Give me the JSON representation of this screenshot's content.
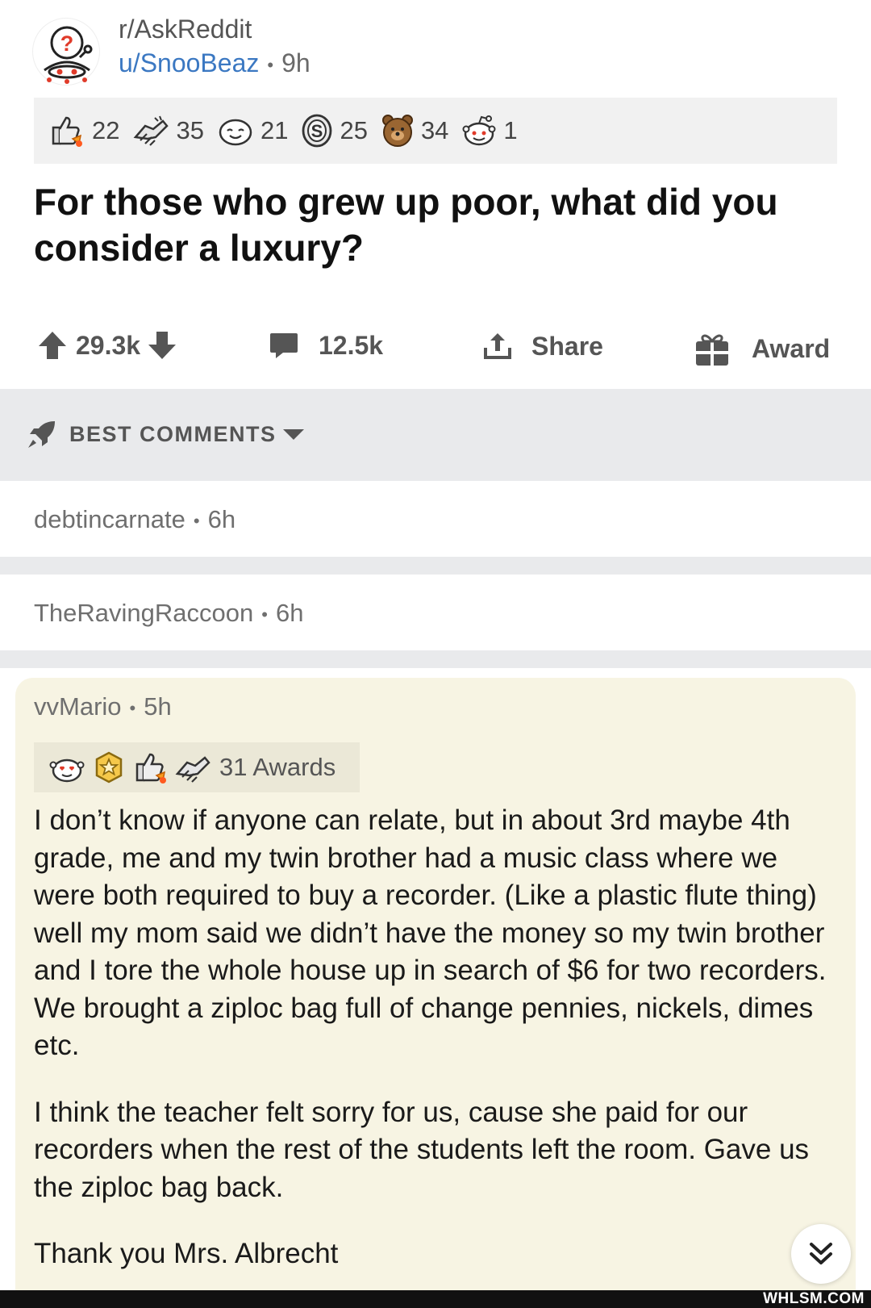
{
  "post": {
    "subreddit": "r/AskReddit",
    "author": "u/SnooBeaz",
    "age": "9h",
    "title": "For those who grew up poor, what did you consider a luxury?",
    "awards": [
      {
        "icon": "thumbs-rocket-icon",
        "count": "22"
      },
      {
        "icon": "helping-hands-icon",
        "count": "35"
      },
      {
        "icon": "wholesome-face-icon",
        "count": "21"
      },
      {
        "icon": "silver-coin-icon",
        "count": "25"
      },
      {
        "icon": "bear-icon",
        "count": "34"
      },
      {
        "icon": "snoo-face-icon",
        "count": "1"
      }
    ]
  },
  "actions": {
    "votes": "29.3k",
    "comments": "12.5k",
    "share": "Share",
    "award": "Award"
  },
  "sort": {
    "label": "BEST COMMENTS"
  },
  "collapsed_comments": [
    {
      "author": "debtincarnate",
      "age": "6h"
    },
    {
      "author": "TheRavingRaccoon",
      "age": "6h"
    }
  ],
  "comment": {
    "author": "vvMario",
    "age": "5h",
    "awards_label": "31 Awards",
    "paragraphs": [
      "I don’t know if anyone can relate, but in about 3rd maybe 4th grade, me and my twin brother had a music class where we were both required to buy a recorder. (Like a plastic flute thing) well my mom said we didn’t have the money so my twin brother and I tore the whole house up in search of $6 for two recorders. We brought a ziploc bag full of change pennies, nickels, dimes etc.",
      "I think the teacher felt sorry for us, cause she paid for our recorders when the rest of the students left the room. Gave us the ziploc bag back.",
      "Thank you Mrs. Albrecht"
    ]
  },
  "watermark": "WHLSM.COM",
  "colors": {
    "username_blue": "#3b78c2",
    "highlight_bg": "#f7f4e3",
    "divider_gray": "#e9eaec"
  }
}
